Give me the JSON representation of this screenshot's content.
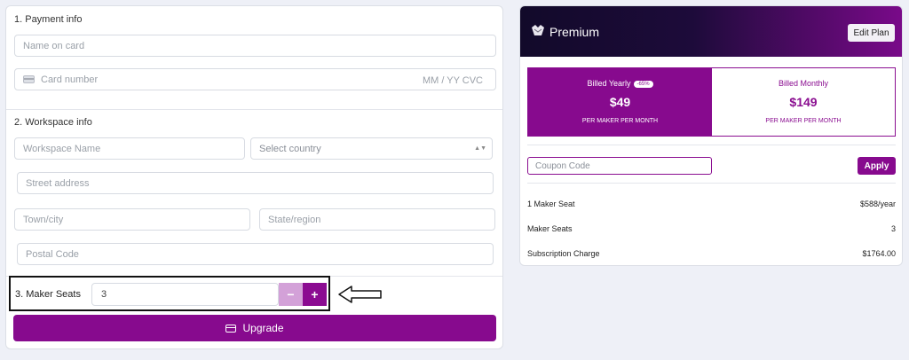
{
  "payment": {
    "title": "1. Payment info",
    "name_placeholder": "Name on card",
    "card_placeholder": "Card number",
    "expiry_cvc_placeholder": "MM / YY  CVC"
  },
  "workspace": {
    "title": "2. Workspace info",
    "name_placeholder": "Workspace Name",
    "country_placeholder": "Select country",
    "street_placeholder": "Street address",
    "city_placeholder": "Town/city",
    "state_placeholder": "State/region",
    "postal_placeholder": "Postal Code"
  },
  "seats": {
    "label": "3. Maker Seats",
    "value": "3",
    "minus": "−",
    "plus": "+"
  },
  "upgrade": {
    "label": "Upgrade"
  },
  "premium": {
    "title": "Premium",
    "edit_label": "Edit Plan",
    "yearly": {
      "name": "Billed Yearly",
      "badge": "-65%",
      "price": "$49",
      "sub": "PER MAKER PER MONTH"
    },
    "monthly": {
      "name": "Billed Monthly",
      "price": "$149",
      "sub": "PER MAKER PER MONTH"
    },
    "coupon_placeholder": "Coupon Code",
    "apply_label": "Apply",
    "summary": [
      {
        "label": "1 Maker Seat",
        "value": "$588/year"
      },
      {
        "label": "Maker Seats",
        "value": "3"
      },
      {
        "label": "Subscription Charge",
        "value": "$1764.00"
      }
    ]
  },
  "colors": {
    "accent": "#870a8e",
    "accent_light": "#d3a1d8",
    "header_dark": "#120a2a",
    "background": "#eef0f7"
  },
  "icons": {
    "card": "credit-card-icon",
    "upgrade": "credit-card-icon",
    "logo": "premium-logo-icon",
    "arrow": "arrow-left-icon"
  }
}
